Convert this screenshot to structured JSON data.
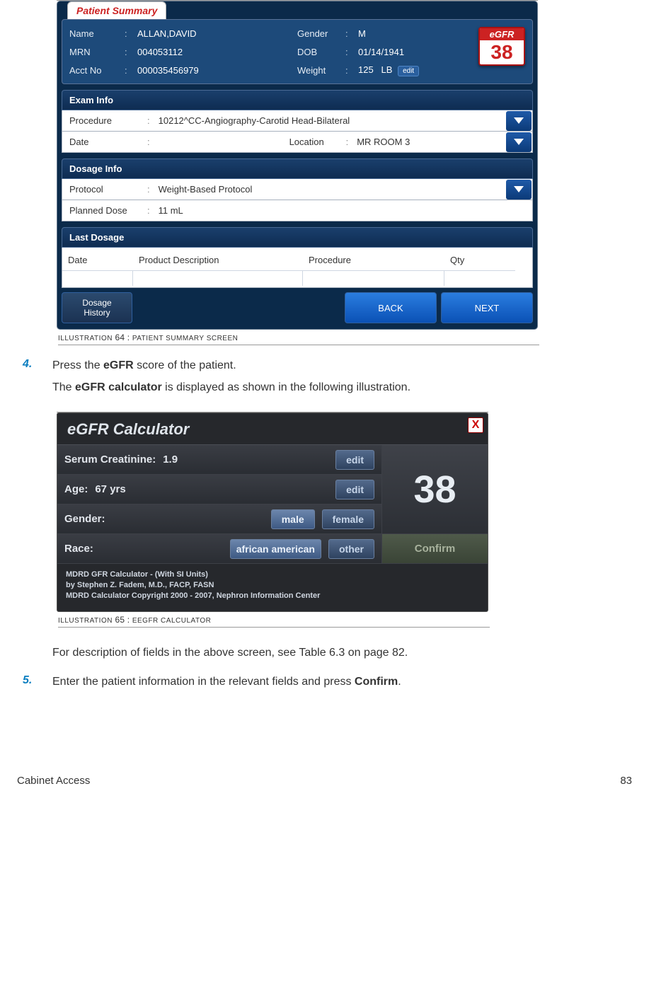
{
  "ps": {
    "tab": "Patient Summary",
    "fields_left": [
      {
        "label": "Name",
        "value": "ALLAN,DAVID"
      },
      {
        "label": "MRN",
        "value": "004053112"
      },
      {
        "label": "Acct No",
        "value": "000035456979"
      }
    ],
    "fields_right": [
      {
        "label": "Gender",
        "value": "M"
      },
      {
        "label": "DOB",
        "value": "01/14/1941"
      },
      {
        "label": "Weight",
        "value": "125",
        "unit": "LB",
        "edit": "edit"
      }
    ],
    "egfr_label": "eGFR",
    "egfr_value": "38",
    "exam_header": "Exam Info",
    "exam_proc_label": "Procedure",
    "exam_proc_value": "10212^CC-Angiography-Carotid Head-Bilateral",
    "exam_date_label": "Date",
    "exam_date_value": "",
    "exam_loc_label": "Location",
    "exam_loc_value": "MR ROOM 3",
    "dosage_header": "Dosage Info",
    "dosage_proto_label": "Protocol",
    "dosage_proto_value": "Weight-Based Protocol",
    "dosage_plan_label": "Planned Dose",
    "dosage_plan_value": "11 mL",
    "last_header": "Last Dosage",
    "last_cols": [
      "Date",
      "Product Description",
      "Procedure",
      "Qty"
    ],
    "foot_history_l1": "Dosage",
    "foot_history_l2": "History",
    "foot_back": "BACK",
    "foot_next": "NEXT"
  },
  "caption1_a": "Illustration",
  "caption1_b": " 64 : ",
  "caption1_c": "Patient Summary screen",
  "step4_num": "4.",
  "step4_a": "Press the ",
  "step4_b": "eGFR",
  "step4_c": " score of the patient.",
  "step4_d1": "The  ",
  "step4_d2": "eGFR calculator",
  "step4_d3": " is displayed as shown in the following illustration.",
  "calc": {
    "title": "eGFR Calculator",
    "sc_label": "Serum Creatinine:",
    "sc_value": "1.9",
    "edit": "edit",
    "age_label": "Age:",
    "age_value": "67 yrs",
    "gender_label": "Gender:",
    "gender_male": "male",
    "gender_female": "female",
    "race_label": "Race:",
    "race_aa": "african american",
    "race_other": "other",
    "score": "38",
    "confirm": "Confirm",
    "foot_l1": "MDRD GFR Calculator - (With SI Units)",
    "foot_l2": "by Stephen Z. Fadem, M.D., FACP, FASN",
    "foot_l3": "MDRD Calculator Copyright 2000 - 2007, Nephron Information Center"
  },
  "caption2_a": "Illustration",
  "caption2_b": " 65 : ",
  "caption2_c": "eGFR Calculator",
  "post1": "For description of fields in the above screen, see Table 6.3 on page 82.",
  "step5_num": "5.",
  "step5_a": "Enter the patient information in the relevant fields and press ",
  "step5_b": "Confirm",
  "step5_c": ".",
  "footer_left": "Cabinet Access",
  "footer_right": "83"
}
